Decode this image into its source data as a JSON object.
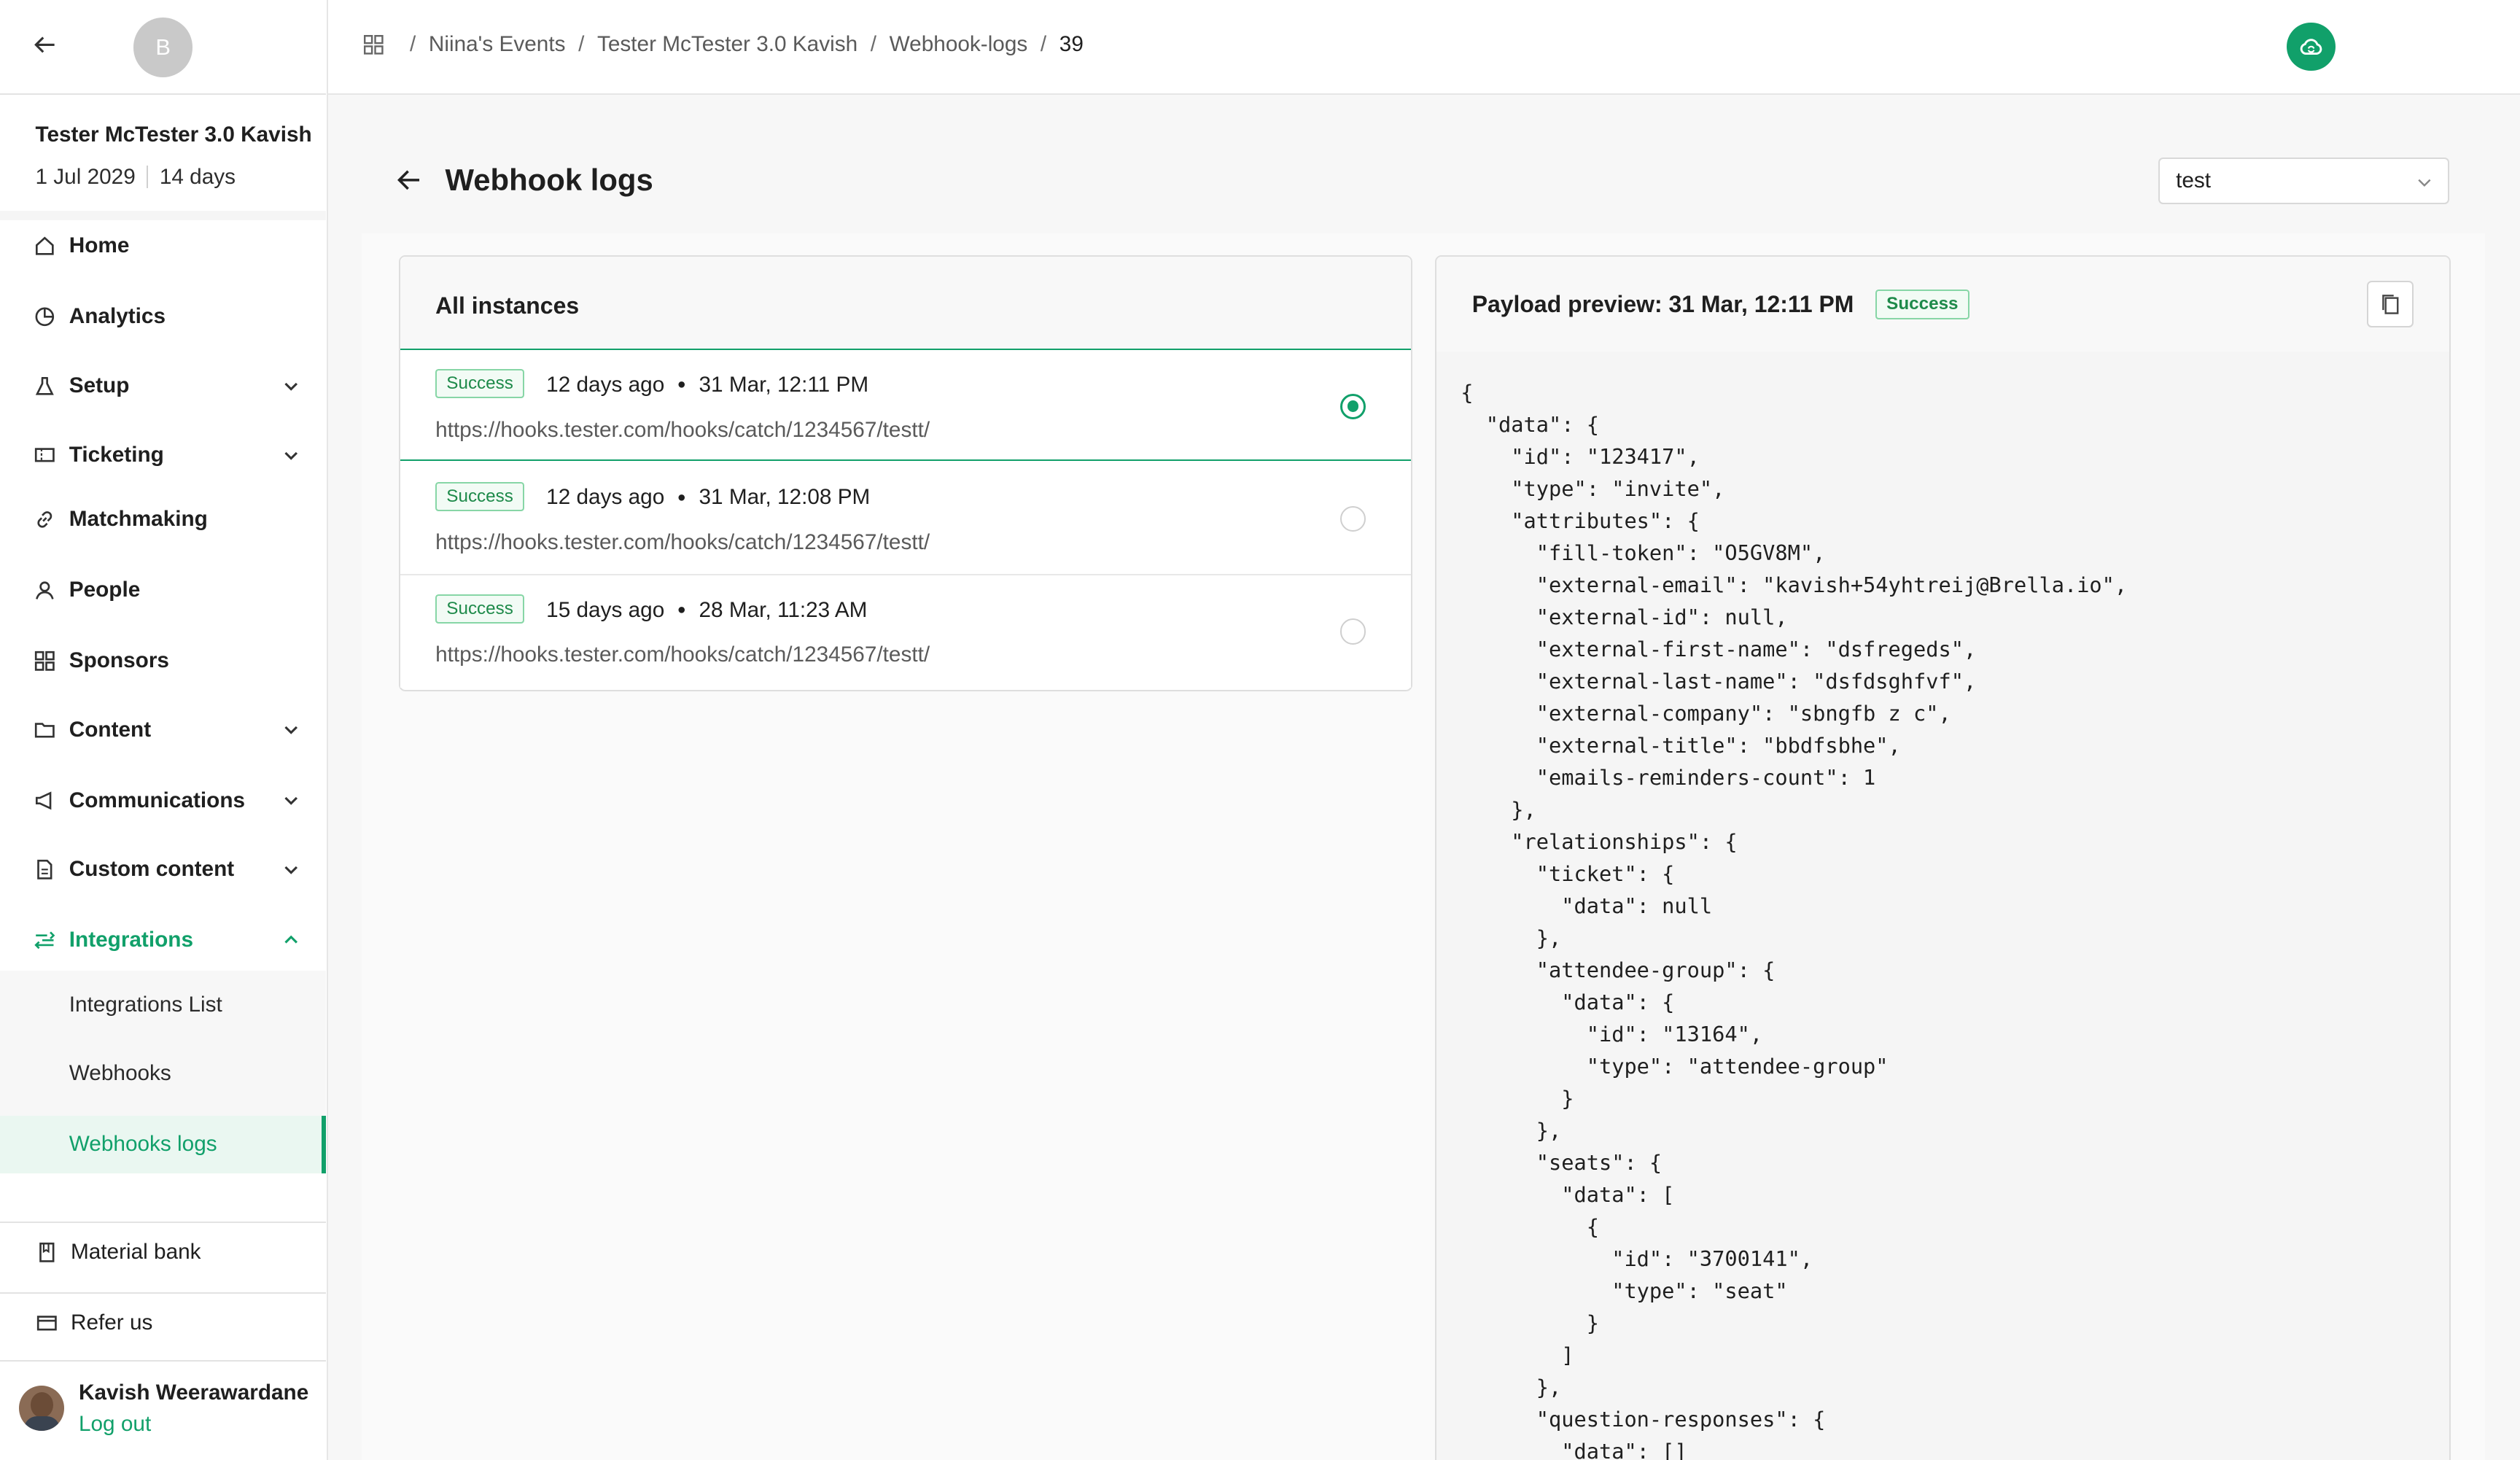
{
  "sidebar": {
    "avatar_initial": "B",
    "event": {
      "name": "Tester McTester 3.0 Kavish",
      "date": "1 Jul 2029",
      "duration": "14 days"
    },
    "nav": {
      "home": "Home",
      "analytics": "Analytics",
      "setup": "Setup",
      "ticketing": "Ticketing",
      "matchmaking": "Matchmaking",
      "people": "People",
      "sponsors": "Sponsors",
      "content": "Content",
      "communications": "Communications",
      "custom_content": "Custom content",
      "integrations": "Integrations"
    },
    "sub_nav": {
      "integrations_list": "Integrations List",
      "webhooks": "Webhooks",
      "webhooks_logs": "Webhooks logs"
    },
    "bottom": {
      "material_bank": "Material bank",
      "refer_us": "Refer us"
    },
    "user": {
      "name": "Kavish Weerawardane",
      "logout": "Log out"
    }
  },
  "breadcrumb": {
    "items": [
      "Niina's Events",
      "Tester McTester 3.0 Kavish",
      "Webhook-logs"
    ],
    "current": "39"
  },
  "main": {
    "title": "Webhook logs",
    "select_value": "test"
  },
  "instances": {
    "heading": "All instances",
    "rows": [
      {
        "status": "Success",
        "ago": "12 days ago",
        "time": "31 Mar, 12:11 PM",
        "url": "https://hooks.tester.com/hooks/catch/1234567/testt/",
        "selected": true
      },
      {
        "status": "Success",
        "ago": "12 days ago",
        "time": "31 Mar, 12:08 PM",
        "url": "https://hooks.tester.com/hooks/catch/1234567/testt/",
        "selected": false
      },
      {
        "status": "Success",
        "ago": "15 days ago",
        "time": "28 Mar, 11:23 AM",
        "url": "https://hooks.tester.com/hooks/catch/1234567/testt/",
        "selected": false
      }
    ]
  },
  "preview": {
    "title": "Payload preview: 31 Mar, 12:11 PM",
    "status": "Success",
    "code_lines": [
      "{",
      "  \"data\": {",
      "    \"id\": \"123417\",",
      "    \"type\": \"invite\",",
      "    \"attributes\": {",
      "      \"fill-token\": \"O5GV8M\",",
      "      \"external-email\": \"kavish+54yhtreij@Brella.io\",",
      "      \"external-id\": null,",
      "      \"external-first-name\": \"dsfregeds\",",
      "      \"external-last-name\": \"dsfdsghfvf\",",
      "      \"external-company\": \"sbngfb z c\",",
      "      \"external-title\": \"bbdfsbhe\",",
      "      \"emails-reminders-count\": 1",
      "    },",
      "    \"relationships\": {",
      "      \"ticket\": {",
      "        \"data\": null",
      "      },",
      "      \"attendee-group\": {",
      "        \"data\": {",
      "          \"id\": \"13164\",",
      "          \"type\": \"attendee-group\"",
      "        }",
      "      },",
      "      \"seats\": {",
      "        \"data\": [",
      "          {",
      "            \"id\": \"3700141\",",
      "            \"type\": \"seat\"",
      "          }",
      "        ]",
      "      },",
      "      \"question-responses\": {",
      "        \"data\": []"
    ]
  },
  "colors": {
    "accent": "#11a06a",
    "success_border": "#87d6a6",
    "success_text": "#1e8a4a"
  }
}
